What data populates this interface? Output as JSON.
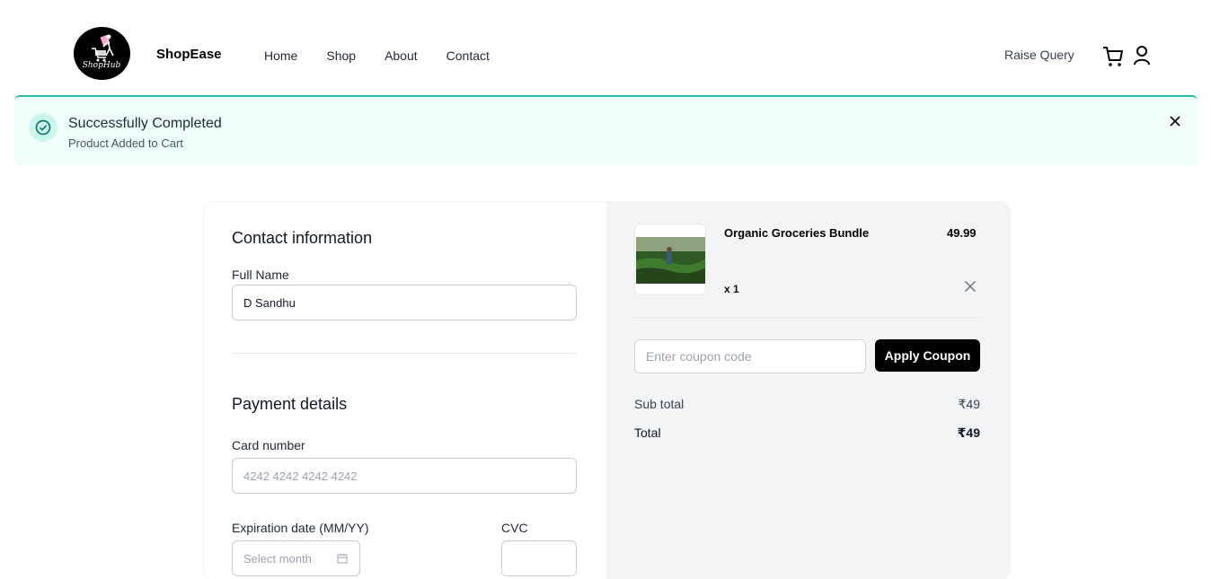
{
  "header": {
    "logo_text": "ShopHub",
    "brand": "ShopEase",
    "nav": [
      "Home",
      "Shop",
      "About",
      "Contact"
    ],
    "raise_query": "Raise Query",
    "icons": {
      "cart": "cart-icon",
      "user": "user-icon"
    }
  },
  "toast": {
    "title": "Successfully Completed",
    "message": "Product Added to Cart",
    "icons": {
      "status": "check-circle-icon",
      "close": "close-icon"
    }
  },
  "checkout": {
    "contact": {
      "heading": "Contact information",
      "full_name_label": "Full Name",
      "full_name_value": "D Sandhu"
    },
    "payment": {
      "heading": "Payment details",
      "card_label": "Card number",
      "card_placeholder": "4242 4242 4242 4242",
      "expiry_label": "Expiration date (MM/YY)",
      "expiry_placeholder": "Select month",
      "cvc_label": "CVC"
    }
  },
  "summary": {
    "product": {
      "name": "Organic Groceries Bundle",
      "price": "49.99",
      "qty": "x 1"
    },
    "coupon": {
      "placeholder": "Enter coupon code",
      "button": "Apply Coupon"
    },
    "subtotal_label": "Sub total",
    "subtotal_value": "₹49",
    "total_label": "Total",
    "total_value": "₹49"
  },
  "colors": {
    "accent": "#2dbba5",
    "toast_bg": "#f0fdfa",
    "summary_bg": "#f3f4f6",
    "button": "#000000"
  }
}
